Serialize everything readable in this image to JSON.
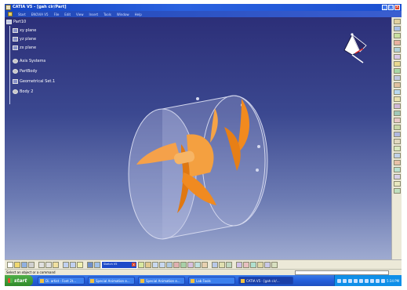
{
  "window": {
    "title": "CATIA V5 - [gah cir/Part]",
    "buttons": {
      "minimize": "_",
      "maximize": "□",
      "close": "x"
    }
  },
  "menu": {
    "items": [
      "Start",
      "ENOVIA V5",
      "File",
      "Edit",
      "View",
      "Insert",
      "Tools",
      "Window",
      "Help"
    ]
  },
  "tree": {
    "root": "Part10",
    "items": [
      "xy plane",
      "yz plane",
      "zx plane",
      "Axis Systems",
      "PartBody",
      "Geometrical Set.1",
      "Body 2"
    ]
  },
  "popup": {
    "title": "Sketch V5",
    "close": "x"
  },
  "status": {
    "message": "Select an object or a command"
  },
  "taskbar": {
    "start": "start",
    "tasks": [
      "Di. artist - Font 2t...",
      "Special Animation e...",
      "Special Animation e...",
      "Lab Fools",
      "CATIA V5 - [gah cir/..."
    ],
    "clock": "5:34 PM"
  },
  "colors": {
    "viewport_top": "#2c2f78",
    "viewport_bottom": "#9eaad0",
    "blade": "#f28a1e",
    "cylinder": "#c6ccea",
    "titlebar": "#1646c4",
    "taskbar": "#245edb",
    "start_button": "#3f9c38"
  }
}
